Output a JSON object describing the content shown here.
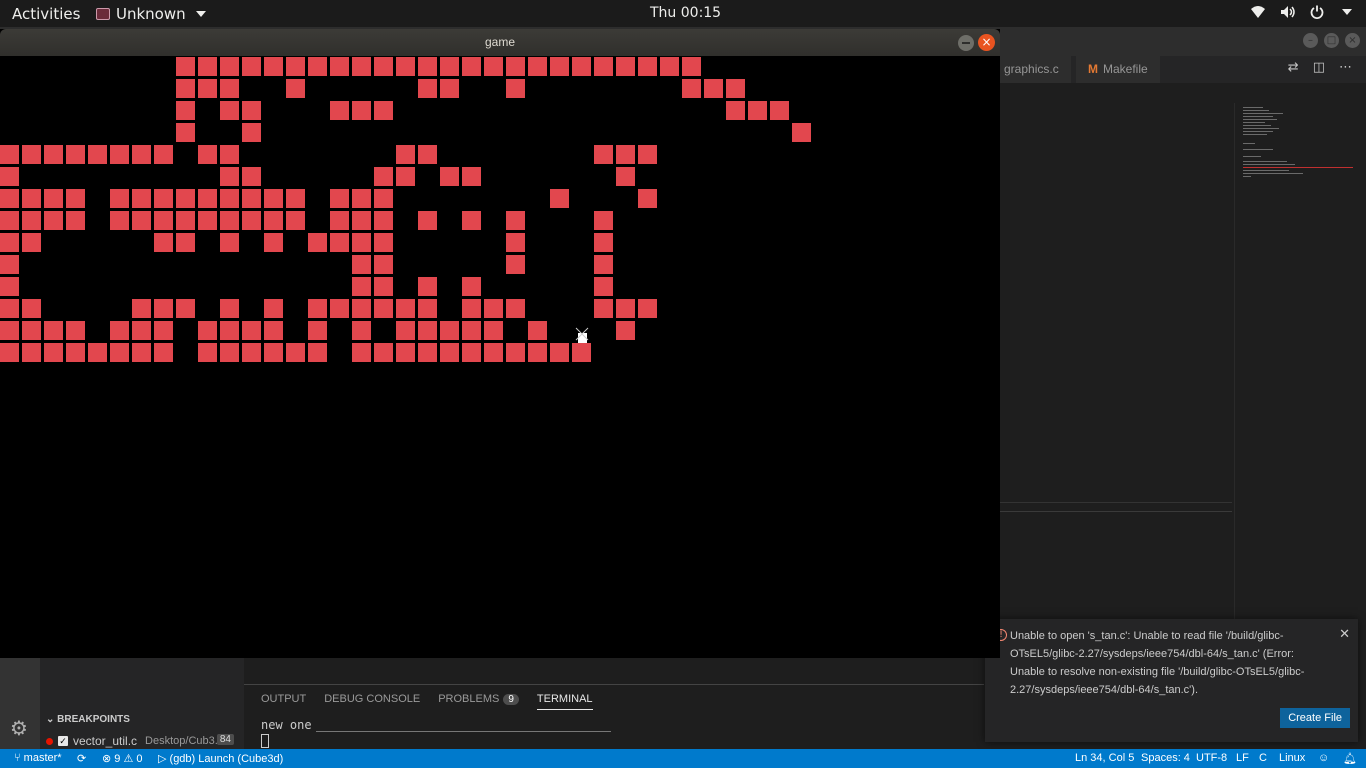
{
  "topbar": {
    "activities": "Activities",
    "app_name": "Unknown",
    "clock": "Thu 00:15"
  },
  "vscode": {
    "tabs": [
      {
        "label": "graphics.c"
      },
      {
        "label": "Makefile",
        "prefix": "M"
      }
    ],
    "breakpoints": {
      "header": "BREAKPOINTS",
      "items": [
        {
          "file": "vector_util.c",
          "path": "Desktop/Cub3...",
          "line": "84"
        }
      ]
    },
    "panel": {
      "tabs": [
        "OUTPUT",
        "DEBUG CONSOLE",
        "PROBLEMS",
        "TERMINAL"
      ],
      "problems_count": "9",
      "active_tab": "TERMINAL",
      "terminal_text": "new one"
    },
    "notification": {
      "message": "Unable to open 's_tan.c': Unable to read file '/build/glibc-OTsEL5/glibc-2.27/sysdeps/ieee754/dbl-64/s_tan.c' (Error: Unable to resolve non-existing file '/build/glibc-OTsEL5/glibc-2.27/sysdeps/ieee754/dbl-64/s_tan.c').",
      "button": "Create File"
    },
    "statusbar": {
      "branch": "master*",
      "errors": "9",
      "warnings": "0",
      "launch": "(gdb) Launch (Cube3d)",
      "position": "Ln 34, Col 5",
      "spaces": "Spaces: 4",
      "encoding": "UTF-8",
      "eol": "LF",
      "language": "C",
      "os": "Linux"
    }
  },
  "game": {
    "title": "game",
    "tile_color": "#e2474e",
    "map": [
      "########################...",
      "###..#.....##..#.......###...",
      "#.##...###...............###.",
      "#..#........................#",
      "########.##.......##.......###",
      "#.........##.....##.##......#",
      "####.#########.###.......#...#",
      "####.#########.###.#.#.#...#.",
      "##.....##.#.#.####.....#...#.",
      "#...............##.....#...#.",
      "#...............##.#.#.....#.",
      "##....###.#.#.######.###...###",
      "####.###.####.#.#.#####.#...#",
      "########.######.###########"
    ]
  }
}
